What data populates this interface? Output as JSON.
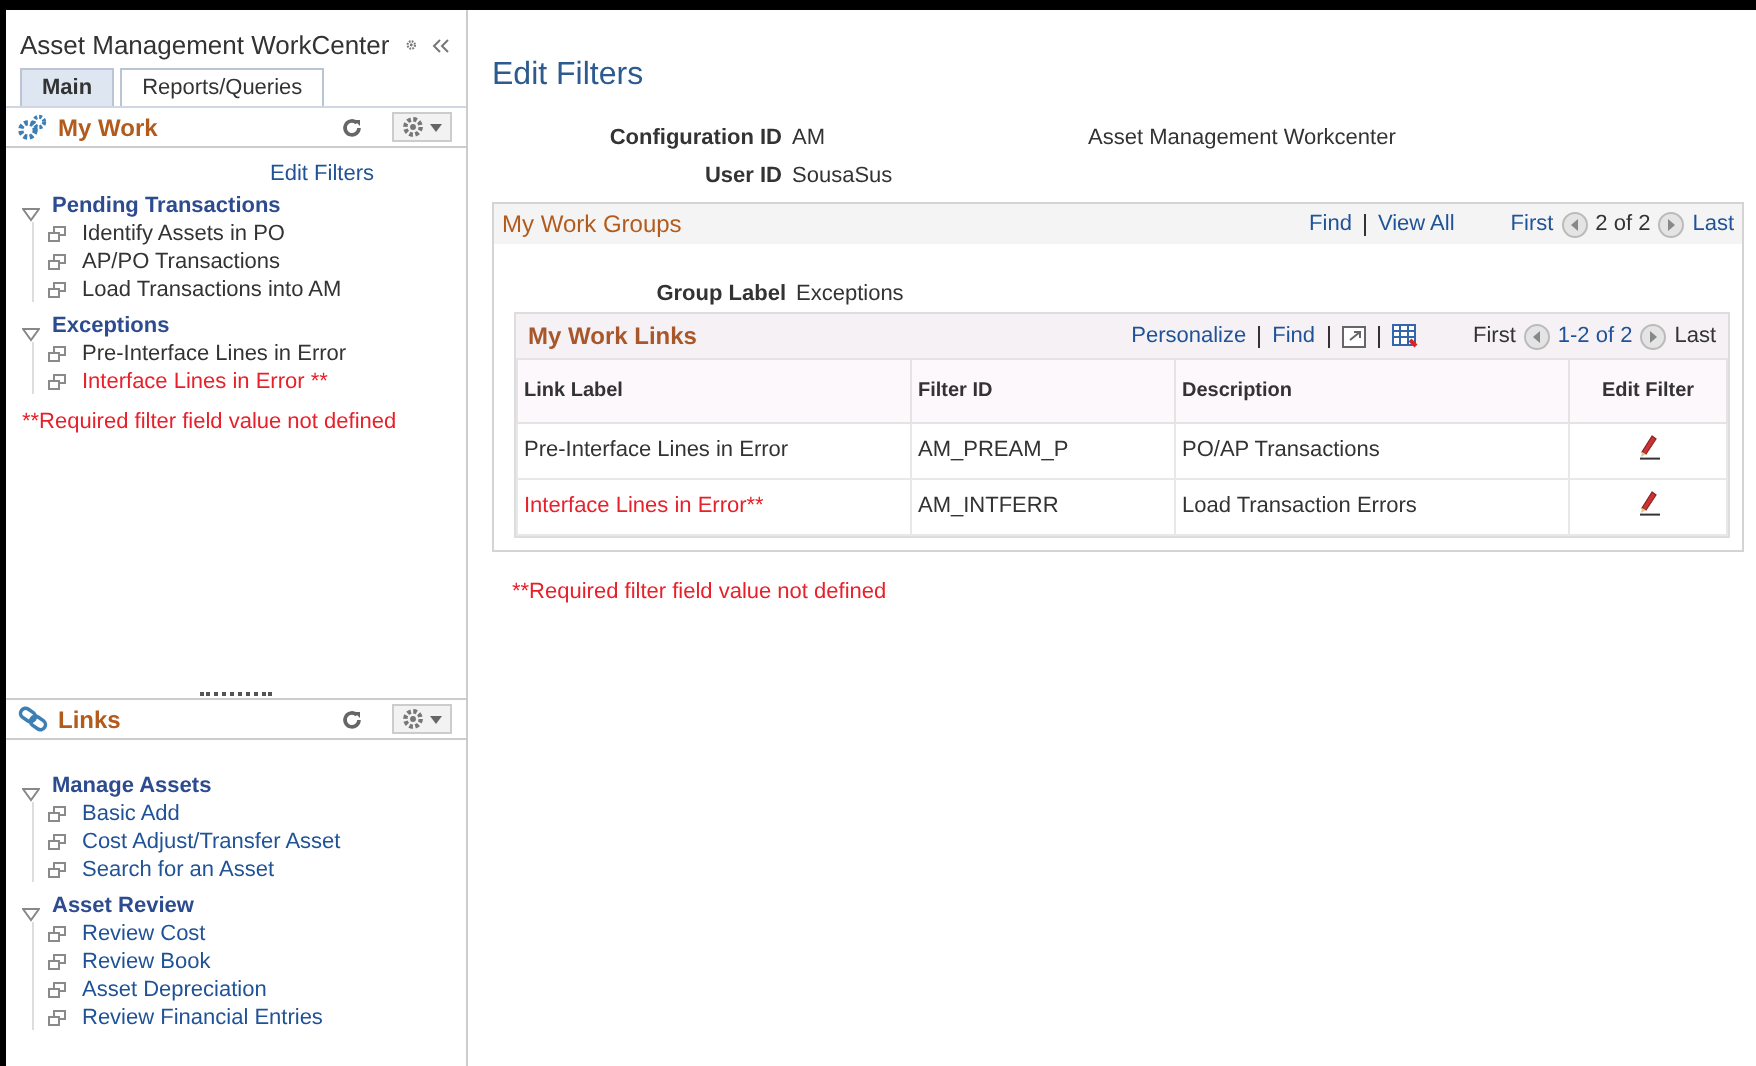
{
  "sidebar": {
    "title": "Asset Management WorkCenter",
    "tabs": [
      {
        "label": "Main",
        "selected": true
      },
      {
        "label": "Reports/Queries",
        "selected": false
      }
    ],
    "pagelets": [
      {
        "kind": "mywork",
        "title": "My Work",
        "link": "Edit Filters",
        "groups": [
          {
            "label": "Pending Transactions",
            "expanded": true,
            "items": [
              {
                "label": "Identify Assets in PO",
                "error": false
              },
              {
                "label": "AP/PO Transactions",
                "error": false
              },
              {
                "label": "Load Transactions into AM",
                "error": false
              }
            ]
          },
          {
            "label": "Exceptions",
            "expanded": true,
            "items": [
              {
                "label": "Pre-Interface Lines in Error",
                "error": false
              },
              {
                "label": "Interface Lines in Error **",
                "error": true
              }
            ]
          }
        ],
        "note": "**Required filter field value not defined"
      },
      {
        "kind": "links",
        "title": "Links",
        "groups": [
          {
            "label": "Manage Assets",
            "expanded": true,
            "items": [
              {
                "label": "Basic Add",
                "error": false
              },
              {
                "label": "Cost Adjust/Transfer Asset",
                "error": false
              },
              {
                "label": "Search for an Asset",
                "error": false
              }
            ]
          },
          {
            "label": "Asset Review",
            "expanded": true,
            "items": [
              {
                "label": "Review Cost",
                "error": false
              },
              {
                "label": "Review Book",
                "error": false
              },
              {
                "label": "Asset Depreciation",
                "error": false
              },
              {
                "label": "Review Financial Entries",
                "error": false
              }
            ]
          }
        ]
      }
    ]
  },
  "main": {
    "title": "Edit Filters",
    "fields": [
      {
        "label": "Configuration ID",
        "value": "AM",
        "description": "Asset Management Workcenter"
      },
      {
        "label": "User ID",
        "value": "SousaSus"
      }
    ],
    "groups_box": {
      "title": "My Work Groups",
      "find": "Find",
      "view_all": "View All",
      "first": "First",
      "range": "2 of 2",
      "last": "Last",
      "group_label": {
        "label": "Group Label",
        "value": "Exceptions"
      },
      "grid": {
        "title": "My Work Links",
        "personalize": "Personalize",
        "find": "Find",
        "first": "First",
        "range": "1-2 of 2",
        "last": "Last",
        "columns": [
          "Link Label",
          "Filter ID",
          "Description",
          "Edit Filter"
        ],
        "rows": [
          {
            "link_label": "Pre-Interface Lines in Error",
            "filter_id": "AM_PREAM_P",
            "description": "PO/AP Transactions",
            "error": false
          },
          {
            "link_label": "Interface Lines in Error**",
            "filter_id": "AM_INTFERR",
            "description": "Load Transaction Errors",
            "error": true
          }
        ]
      }
    },
    "note": "**Required filter field value not defined"
  }
}
